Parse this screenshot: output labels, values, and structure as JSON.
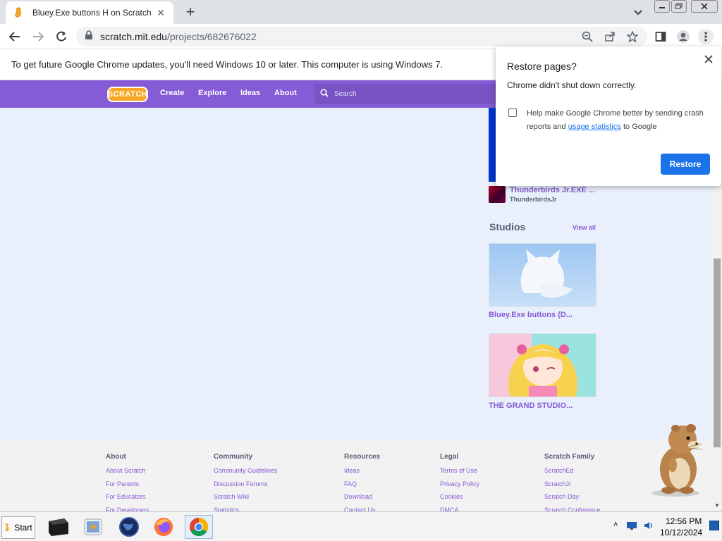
{
  "browser": {
    "tab_title": "Bluey.Exe buttons H on Scratch",
    "tab_close": "✕",
    "new_tab": "+",
    "url_domain": "scratch.mit.edu",
    "url_path": "/projects/682676022"
  },
  "infobar": {
    "text": "To get future Google Chrome updates, you'll need Windows 10 or later. This computer is using Windows 7."
  },
  "scratch_nav": {
    "logo": "SCRATCH",
    "links": [
      "Create",
      "Explore",
      "Ideas",
      "About"
    ],
    "search_placeholder": "Search"
  },
  "sidebar": {
    "remix": {
      "title": "Thunderbirds Jr.EXE ...",
      "author": "ThunderbirdsJr"
    },
    "studios_heading": "Studios",
    "view_all": "View all",
    "studios": [
      {
        "title": "Bluey.Exe buttons (D..."
      },
      {
        "title": "THE GRAND STUDIO..."
      }
    ]
  },
  "footer": {
    "columns": [
      {
        "heading": "About",
        "links": [
          "About Scratch",
          "For Parents",
          "For Educators",
          "For Developers"
        ]
      },
      {
        "heading": "Community",
        "links": [
          "Community Guidelines",
          "Discussion Forums",
          "Scratch Wiki",
          "Statistics"
        ]
      },
      {
        "heading": "Resources",
        "links": [
          "Ideas",
          "FAQ",
          "Download",
          "Contact Us"
        ]
      },
      {
        "heading": "Legal",
        "links": [
          "Terms of Use",
          "Privacy Policy",
          "Cookies",
          "DMCA"
        ]
      },
      {
        "heading": "Scratch Family",
        "links": [
          "ScratchEd",
          "ScratchJr",
          "Scratch Day",
          "Scratch Conference"
        ]
      }
    ]
  },
  "popup": {
    "title": "Restore pages?",
    "message": "Chrome didn't shut down correctly.",
    "consent_before": "Help make Google Chrome better by sending crash reports and ",
    "consent_link": "usage statistics",
    "consent_after": " to Google",
    "restore_button": "Restore",
    "checkbox_checked": false
  },
  "taskbar": {
    "start_label": "Start",
    "apps": [
      "cmd-icon",
      "media-player-icon",
      "globe-icon",
      "firefox-icon",
      "chrome-icon"
    ],
    "time": "12:56 PM",
    "date": "10/12/2024"
  },
  "colors": {
    "scratch_purple": "#855cd6",
    "chrome_blue": "#1a73e8",
    "page_bg": "#e9f0fb"
  }
}
